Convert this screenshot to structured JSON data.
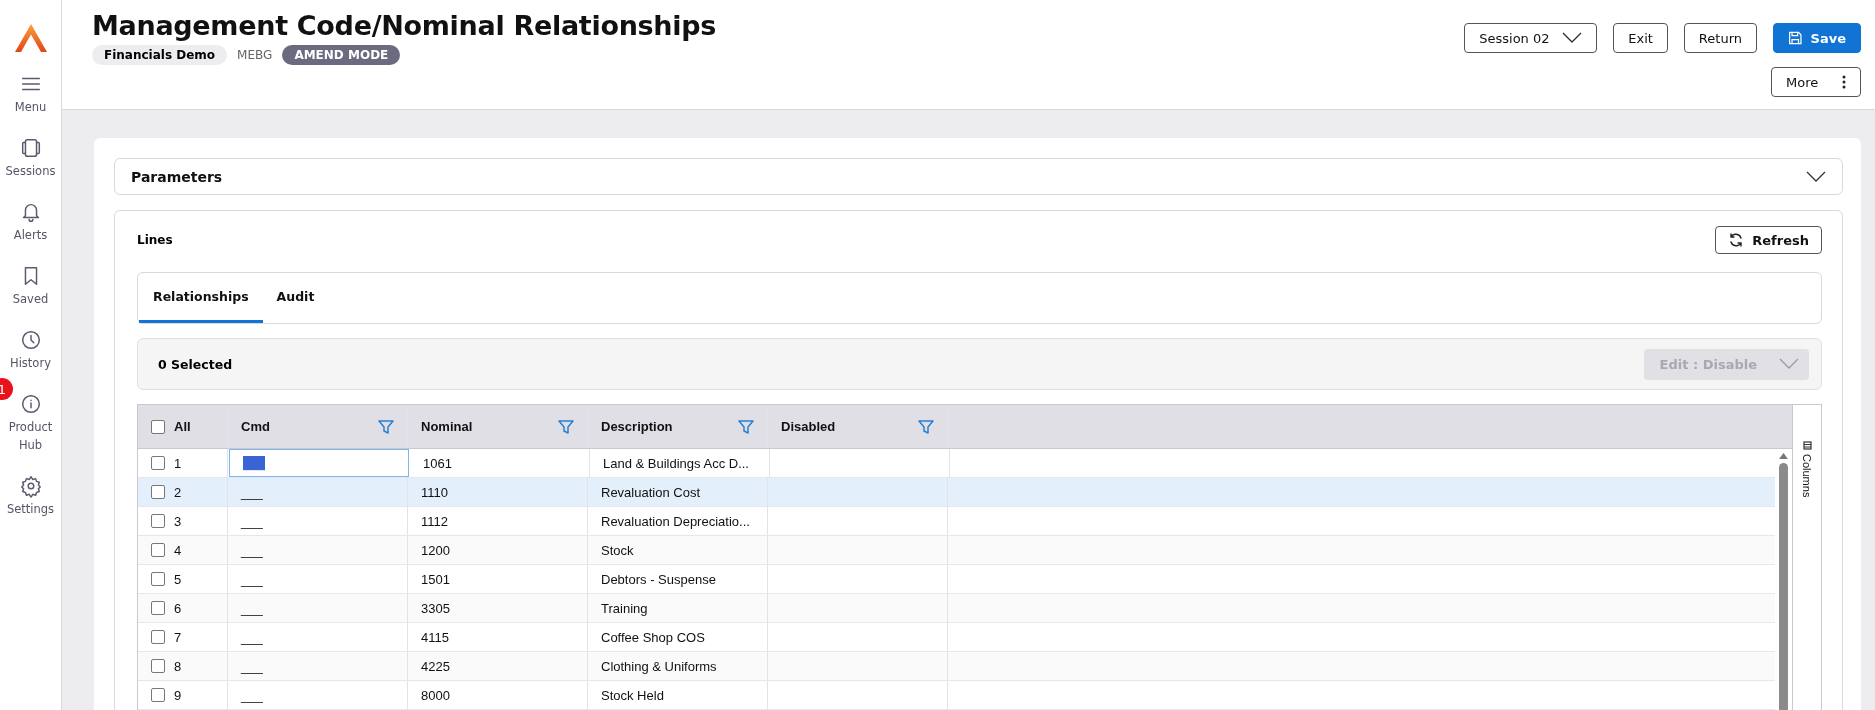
{
  "sidebar": {
    "items": [
      {
        "label": "Menu"
      },
      {
        "label": "Sessions"
      },
      {
        "label": "Alerts"
      },
      {
        "label": "Saved"
      },
      {
        "label": "History"
      },
      {
        "label": "Product Hub",
        "badge": "1"
      },
      {
        "label": "Settings"
      }
    ]
  },
  "header": {
    "title": "Management Code/Nominal Relationships",
    "tags": [
      {
        "label": "Financials Demo",
        "kind": "chip"
      },
      {
        "label": "MEBG",
        "kind": "plain"
      },
      {
        "label": "AMEND MODE",
        "kind": "mode"
      }
    ],
    "session": "Session 02",
    "buttons": [
      {
        "label": "Exit",
        "kind": "outline"
      },
      {
        "label": "Return",
        "kind": "outline"
      },
      {
        "label": "Save",
        "kind": "primary"
      }
    ],
    "more": "More"
  },
  "parameters": {
    "title": "Parameters",
    "expanded": false
  },
  "lines": {
    "title": "Lines",
    "refresh": "Refresh",
    "tabs": [
      {
        "label": "Relationships",
        "selected": true
      },
      {
        "label": "Audit",
        "selected": false
      }
    ],
    "selection": "0 Selected",
    "action": {
      "label": "Edit : Disable",
      "disabled": true
    }
  },
  "table": {
    "select_all": {
      "label": "All",
      "checked": false
    },
    "columns": [
      "Cmd",
      "Nominal",
      "Description",
      "Disabled"
    ],
    "rows": [
      {
        "number": "1",
        "checked": false,
        "editing": true,
        "highlighted": false,
        "cmd": "___",
        "nominal": "1061",
        "description": "Land & Buildings Acc D..."
      },
      {
        "number": "2",
        "checked": false,
        "editing": false,
        "highlighted": true,
        "cmd": "___",
        "nominal": "1110",
        "description": "Revaluation Cost"
      },
      {
        "number": "3",
        "checked": false,
        "editing": false,
        "highlighted": false,
        "cmd": "___",
        "nominal": "1112",
        "description": "Revaluation Depreciatio..."
      },
      {
        "number": "4",
        "checked": false,
        "editing": false,
        "highlighted": false,
        "cmd": "___",
        "nominal": "1200",
        "description": "Stock"
      },
      {
        "number": "5",
        "checked": false,
        "editing": false,
        "highlighted": false,
        "cmd": "___",
        "nominal": "1501",
        "description": "Debtors - Suspense"
      },
      {
        "number": "6",
        "checked": false,
        "editing": false,
        "highlighted": false,
        "cmd": "___",
        "nominal": "3305",
        "description": "Training"
      },
      {
        "number": "7",
        "checked": false,
        "editing": false,
        "highlighted": false,
        "cmd": "___",
        "nominal": "4115",
        "description": "Coffee Shop COS"
      },
      {
        "number": "8",
        "checked": false,
        "editing": false,
        "highlighted": false,
        "cmd": "___",
        "nominal": "4225",
        "description": "Clothing & Uniforms"
      },
      {
        "number": "9",
        "checked": false,
        "editing": false,
        "highlighted": false,
        "cmd": "___",
        "nominal": "8000",
        "description": "Stock Held"
      }
    ],
    "side_panel": "Columns"
  }
}
